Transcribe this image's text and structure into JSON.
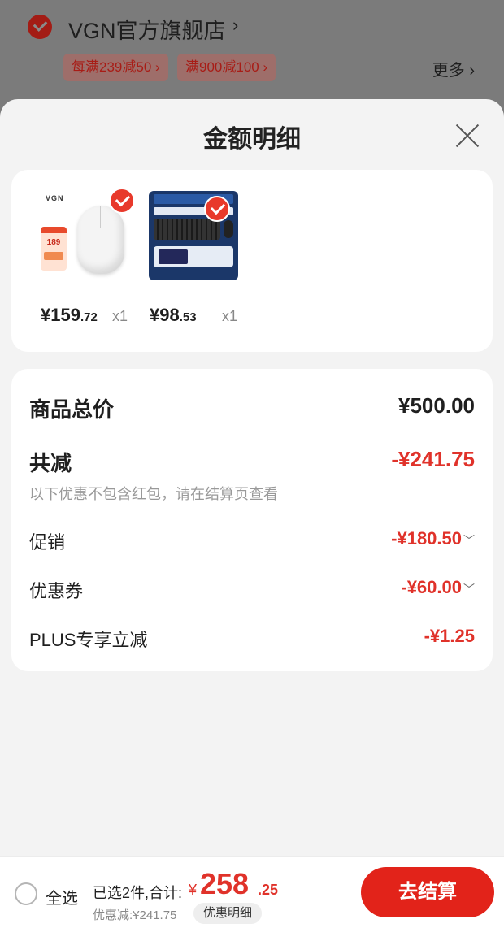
{
  "shop": {
    "name": "VGN官方旗舰店",
    "promos": [
      "每满239减50 ›",
      "满900减100 ›"
    ],
    "more_label": "更多 ›"
  },
  "sheet": {
    "title": "金额明细"
  },
  "products": [
    {
      "price_int": "¥159",
      "price_dec": ".72",
      "qty": "x1",
      "image_text": [
        "VGN",
        "189"
      ]
    },
    {
      "price_int": "¥98",
      "price_dec": ".53",
      "qty": "x1"
    }
  ],
  "summary": {
    "total_label": "商品总价",
    "total_value": "¥500.00",
    "discount_label": "共减",
    "discount_value": "-¥241.75",
    "discount_note": "以下优惠不包含红包，请在结算页查看",
    "promo_label": "促销",
    "promo_value": "-¥180.50",
    "coupon_label": "优惠券",
    "coupon_value": "-¥60.00",
    "plus_label": "PLUS专享立减",
    "plus_value": "-¥1.25"
  },
  "bottom": {
    "select_all": "全选",
    "selected_count": "已选2件,合计:",
    "currency": "¥",
    "total_int": "258",
    "total_dec": ".25",
    "saved": "优惠减:¥241.75",
    "detail_button": "优惠明细",
    "checkout_button": "去结算"
  },
  "colors": {
    "accent": "#e2231a",
    "discount_text": "#e0322a",
    "sheet_bg": "#f3f3f3"
  }
}
